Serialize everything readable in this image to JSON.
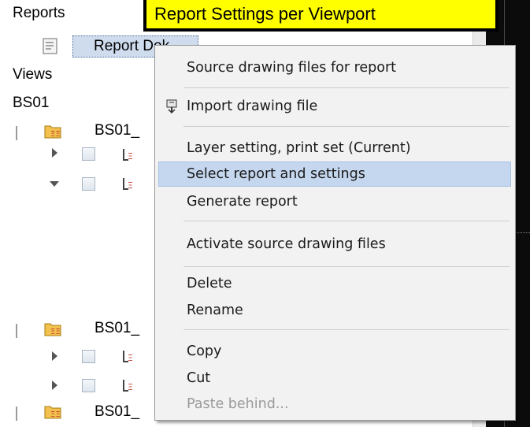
{
  "callout": {
    "text": "Report Settings per Viewport"
  },
  "tree": {
    "reports_label": "Reports",
    "report_item": "Report Dok",
    "views_label": "Views",
    "bs01_label": "BS01",
    "view_row_1": "BS01_",
    "view_row_2": "BS01_",
    "view_row_3": "BS01_"
  },
  "menu": {
    "items": [
      {
        "label": "Source drawing files for report",
        "icon": ""
      },
      {
        "label": "Import drawing file",
        "icon": "import-icon"
      },
      {
        "label": "Layer setting, print set (Current)",
        "icon": ""
      },
      {
        "label": "Select report and settings",
        "icon": "",
        "selected": true
      },
      {
        "label": "Generate report",
        "icon": ""
      },
      {
        "label": "Activate source drawing files",
        "icon": ""
      },
      {
        "label": "Delete",
        "icon": ""
      },
      {
        "label": "Rename",
        "icon": ""
      },
      {
        "label": "Copy",
        "icon": ""
      },
      {
        "label": "Cut",
        "icon": ""
      },
      {
        "label": "Paste behind...",
        "icon": "",
        "disabled": true
      }
    ]
  },
  "colors": {
    "callout_bg": "#ffff00",
    "selection_bg": "#c5d7ef",
    "menu_bg": "#f2f2f2"
  }
}
